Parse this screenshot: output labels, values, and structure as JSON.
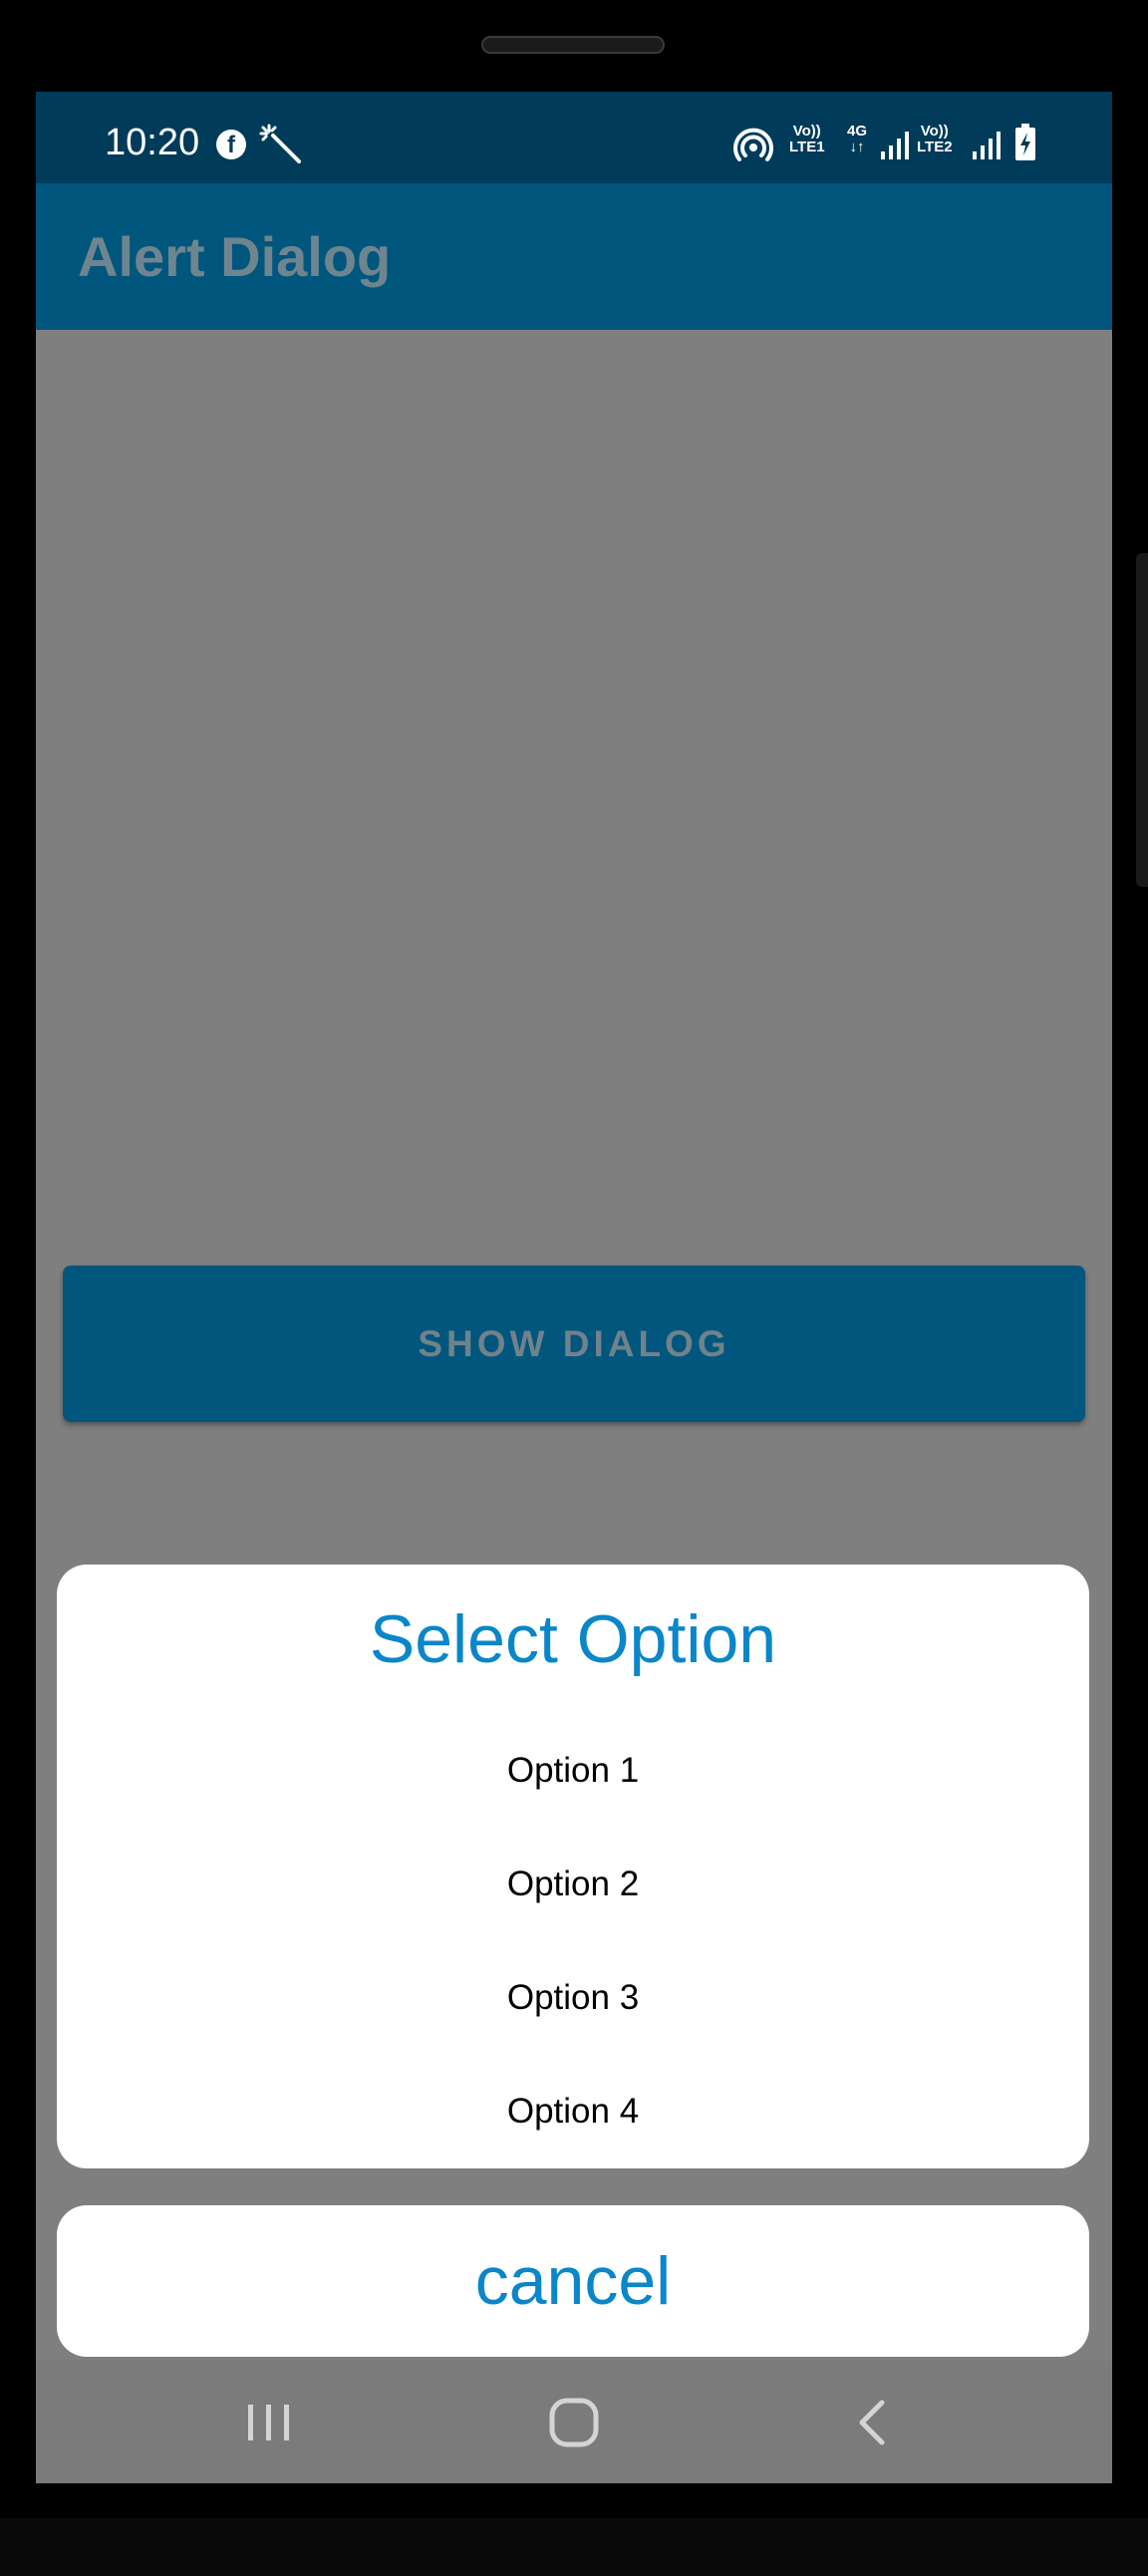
{
  "status_bar": {
    "time": "10:20",
    "facebook_glyph": "f",
    "sim1_voice": "Vo))",
    "sim1_lte": "LTE1",
    "network_type": "4G",
    "sim2_voice": "Vo))",
    "sim2_lte": "LTE2",
    "icons": [
      "facebook-icon",
      "magic-wand-icon",
      "hotspot-icon",
      "signal-icon",
      "signal-icon",
      "battery-charging-icon"
    ]
  },
  "app_bar": {
    "title": "Alert Dialog"
  },
  "main": {
    "show_dialog_label": "SHOW DIALOG"
  },
  "dialog": {
    "title": "Select Option",
    "options": [
      {
        "label": "Option 1"
      },
      {
        "label": "Option 2"
      },
      {
        "label": "Option 3"
      },
      {
        "label": "Option 4"
      }
    ],
    "cancel_label": "cancel"
  },
  "nav_bar": {
    "icons": [
      "recents-icon",
      "home-icon",
      "back-icon"
    ]
  },
  "colors": {
    "status_bar": "#003b5a",
    "app_bar": "#00567d",
    "accent": "#0a86c9",
    "scrim": "#7f7f7f"
  }
}
